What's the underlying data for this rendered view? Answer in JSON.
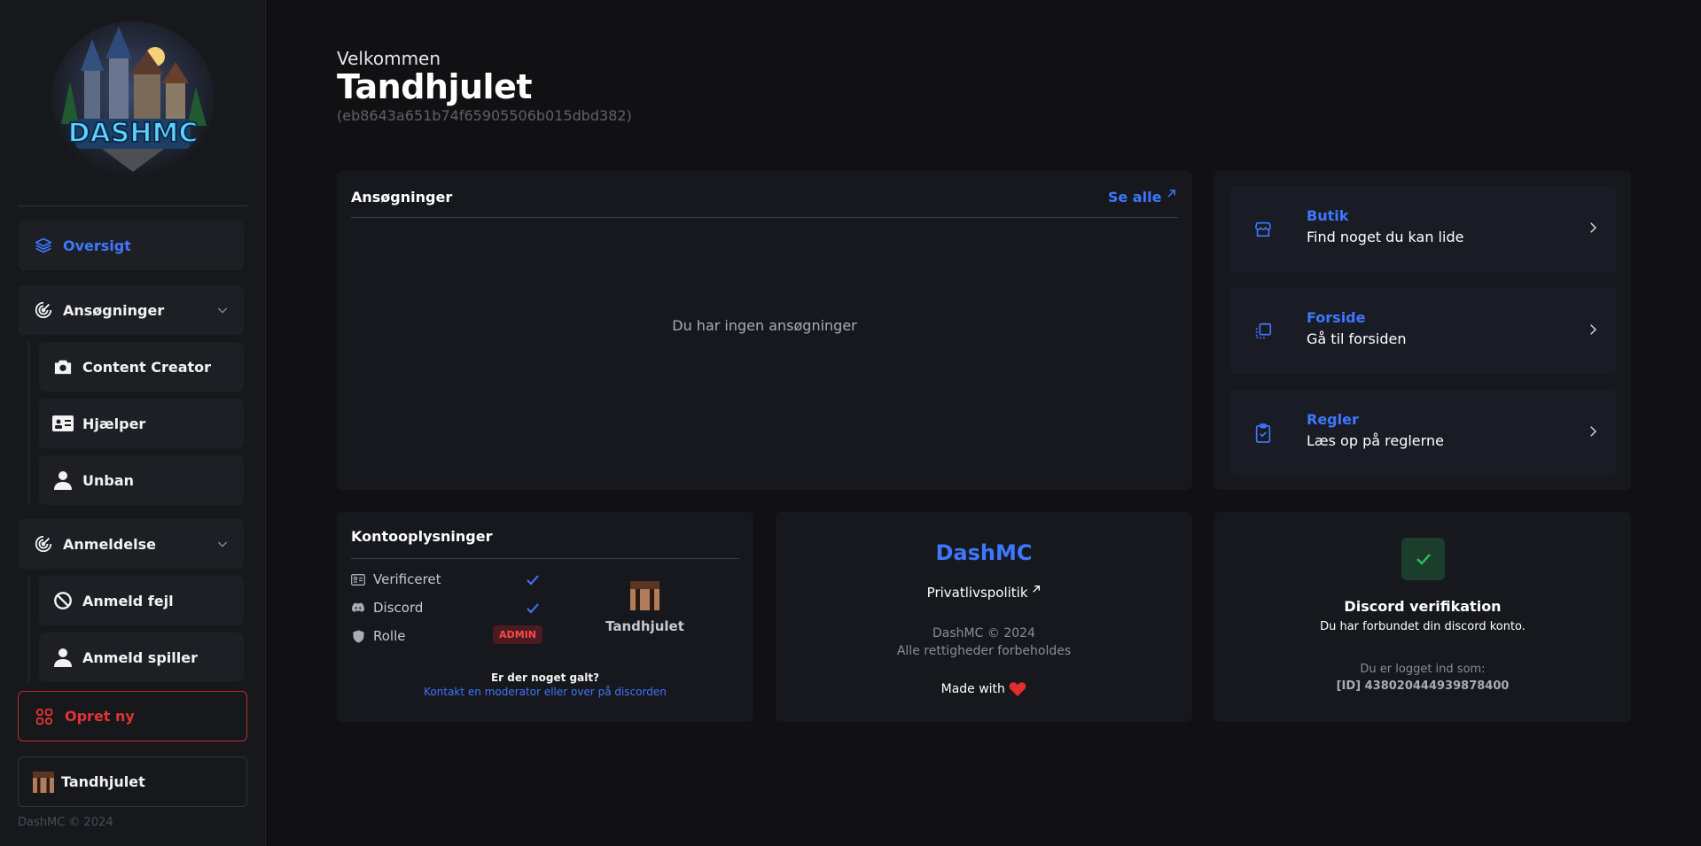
{
  "sidebar": {
    "brand": "DASHMC",
    "nav": {
      "overview": "Oversigt",
      "applications": "Ansøgninger",
      "content_creator": "Content Creator",
      "helper": "Hjælper",
      "unban": "Unban",
      "reports": "Anmeldelse",
      "report_bug": "Anmeld fejl",
      "report_player": "Anmeld spiller",
      "create_new": "Opret ny"
    },
    "user": "Tandhjulet",
    "footer": "DashMC © 2024"
  },
  "header": {
    "welcome": "Velkommen",
    "username": "Tandhjulet",
    "uuid": "(eb8643a651b74f65905506b015dbd382)"
  },
  "applications_card": {
    "title": "Ansøgninger",
    "see_all": "Se alle",
    "empty_text": "Du har ingen ansøgninger"
  },
  "quick_links": [
    {
      "title": "Butik",
      "subtitle": "Find noget du kan lide"
    },
    {
      "title": "Forside",
      "subtitle": "Gå til forsiden"
    },
    {
      "title": "Regler",
      "subtitle": "Læs op på reglerne"
    }
  ],
  "account_card": {
    "title": "Kontooplysninger",
    "verified": "Verificeret",
    "discord": "Discord",
    "role": "Rolle",
    "role_badge": "ADMIN",
    "username": "Tandhjulet",
    "help_question": "Er der noget galt?",
    "help_link": "Kontakt en moderator eller over på discorden"
  },
  "brand_card": {
    "name": "DashMC",
    "privacy": "Privatlivspolitik",
    "copyright": "DashMC © 2024",
    "rights": "Alle rettigheder forbeholdes",
    "made_with": "Made with"
  },
  "discord_card": {
    "title": "Discord verifikation",
    "subtitle": "Du har forbundet din discord konto.",
    "logged_in_as": "Du er logget ind som:",
    "id": "[ID] 438020444939878400"
  },
  "colors": {
    "accent": "#3e77ff",
    "danger": "#e13333",
    "success": "#2fbf63",
    "background": "#111113",
    "card": "#17181d"
  }
}
